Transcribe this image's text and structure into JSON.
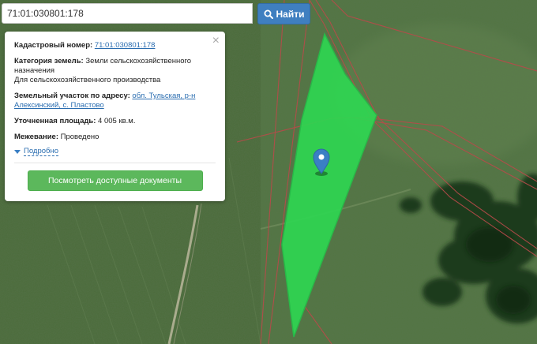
{
  "search": {
    "value": "71:01:030801:178",
    "button_label": "Найти"
  },
  "panel": {
    "close_glyph": "×",
    "cadastral": {
      "label": "Кадастровый номер:",
      "value": "71:01:030801:178"
    },
    "category": {
      "label": "Категория земель:",
      "value": "Земли сельскохозяйственного назначения",
      "usage": "Для сельскохозяйственного производства"
    },
    "address": {
      "label": "Земельный участок по адресу:",
      "value": "обл. Тульская, р-н Алексинский, с. Пластово"
    },
    "area": {
      "label": "Уточненная площадь:",
      "value": "4 005 кв.м."
    },
    "survey": {
      "label": "Межевание:",
      "value": "Проведено"
    },
    "more_label": "Подробно",
    "docs_button": "Посмотреть доступные документы"
  },
  "colors": {
    "parcel_fill": "#2fd651",
    "boundary": "#b84a4a",
    "search_button": "#3f7fc0",
    "docs_button": "#5cb85c",
    "marker": "#3a7fc4",
    "link": "#2a6db0"
  },
  "icons": {
    "search": "search-icon",
    "marker": "map-marker-icon",
    "close": "close-icon",
    "expand": "caret-down-icon"
  }
}
